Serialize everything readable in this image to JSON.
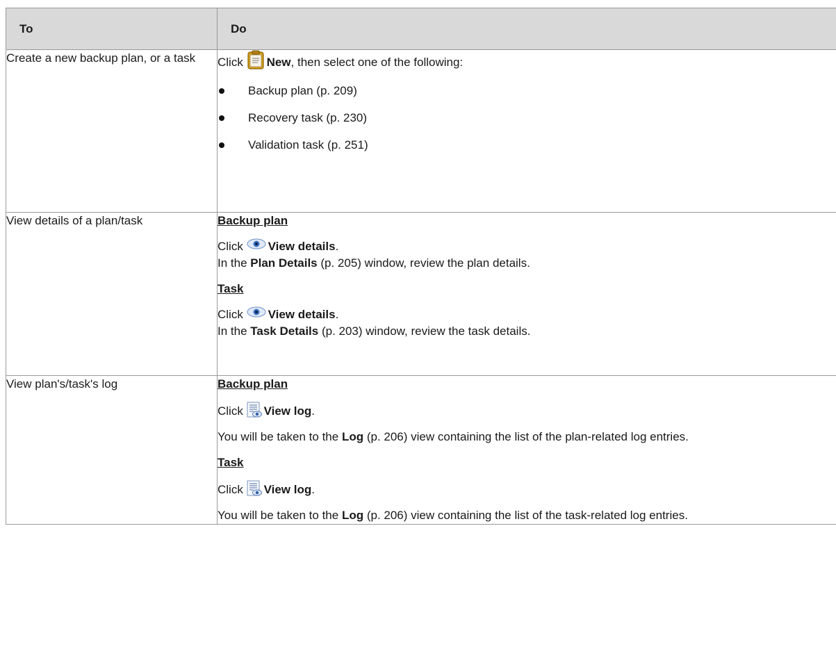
{
  "header": {
    "col1": "To",
    "col2": "Do"
  },
  "rows": [
    {
      "to": "Create a new backup plan, or a task",
      "do": {
        "click": "Click ",
        "action": "New",
        "tail": ", then select one of the following:",
        "bullets": [
          "Backup plan (p. 209)",
          "Recovery task (p. 230)",
          "Validation task (p. 251)"
        ]
      }
    },
    {
      "to": "View details of a plan/task",
      "do": {
        "sec1": {
          "title": "Backup plan",
          "click": "Click ",
          "action": "View details",
          "dot": ".",
          "in_the": "In the ",
          "window_name": "Plan Details",
          "rest": " (p. 205) window, review the plan details."
        },
        "sec2": {
          "title": "Task",
          "click": "Click ",
          "action": "View details",
          "dot": ".",
          "in_the": "In the ",
          "window_name": "Task Details",
          "rest": " (p. 203) window, review the task details."
        }
      }
    },
    {
      "to": "View plan's/task's log",
      "do": {
        "sec1": {
          "title": "Backup plan",
          "click": "Click ",
          "action": "View log",
          "dot": ".",
          "pre": "You will be taken to the ",
          "view_name": "Log",
          "rest": " (p. 206) view containing the list of the plan-related log entries."
        },
        "sec2": {
          "title": "Task",
          "click": "Click ",
          "action": "View log",
          "dot": ".",
          "pre": "You will be taken to the ",
          "view_name": "Log",
          "rest": " (p. 206) view containing the list of the task-related log entries."
        }
      }
    }
  ],
  "icons": {
    "new": "new-plan-icon",
    "view_details": "eye-icon",
    "view_log": "log-icon"
  }
}
